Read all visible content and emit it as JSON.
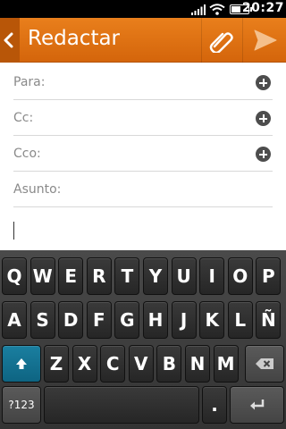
{
  "status": {
    "time": "20:27",
    "battery_level": 0.6
  },
  "header": {
    "title": "Redactar"
  },
  "form": {
    "to_label": "Para:",
    "cc_label": "Cc:",
    "bcc_label": "Cco:",
    "subject_label": "Asunto:"
  },
  "keyboard": {
    "row1": [
      "Q",
      "W",
      "E",
      "R",
      "T",
      "Y",
      "U",
      "I",
      "O",
      "P"
    ],
    "row2": [
      "A",
      "S",
      "D",
      "F",
      "G",
      "H",
      "J",
      "K",
      "L",
      "Ñ"
    ],
    "row3": [
      "Z",
      "X",
      "C",
      "V",
      "B",
      "N",
      "M"
    ],
    "symbols_label": "?123",
    "period_label": "."
  }
}
